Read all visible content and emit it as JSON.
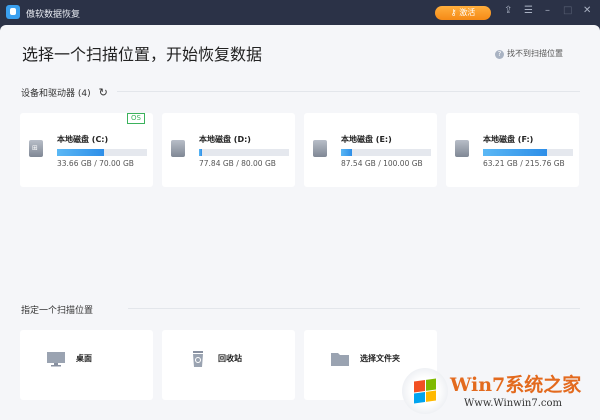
{
  "app": {
    "title": "傲软数据恢复",
    "activate_label": "激活"
  },
  "main": {
    "heading": "选择一个扫描位置，开始恢复数据",
    "help_link": "找不到扫描位置"
  },
  "devices": {
    "title": "设备和驱动器 (4)",
    "drives": [
      {
        "name": "本地磁盘 (C:)",
        "size": "33.66 GB / 70.00 GB",
        "fill_percent": 52,
        "badge": "OS",
        "icon": "windows-drive-icon"
      },
      {
        "name": "本地磁盘 (D:)",
        "size": "77.84 GB / 80.00 GB",
        "fill_percent": 3,
        "icon": "drive-icon"
      },
      {
        "name": "本地磁盘 (E:)",
        "size": "87.54 GB / 100.00 GB",
        "fill_percent": 12,
        "icon": "drive-icon"
      },
      {
        "name": "本地磁盘 (F:)",
        "size": "63.21 GB / 215.76 GB",
        "fill_percent": 71,
        "icon": "drive-icon"
      }
    ]
  },
  "locations": {
    "title": "指定一个扫描位置",
    "items": [
      {
        "name": "桌面",
        "icon": "desktop-icon"
      },
      {
        "name": "回收站",
        "icon": "recycle-bin-icon"
      },
      {
        "name": "选择文件夹",
        "icon": "folder-icon"
      }
    ]
  },
  "watermark": {
    "brand": "Win7系统之家",
    "url": "Www.Winwin7.com"
  },
  "colors": {
    "titlebar": "#2b3247",
    "accent": "#2d8ee8",
    "activate": "#f58a16",
    "os_badge": "#3bb25c"
  }
}
